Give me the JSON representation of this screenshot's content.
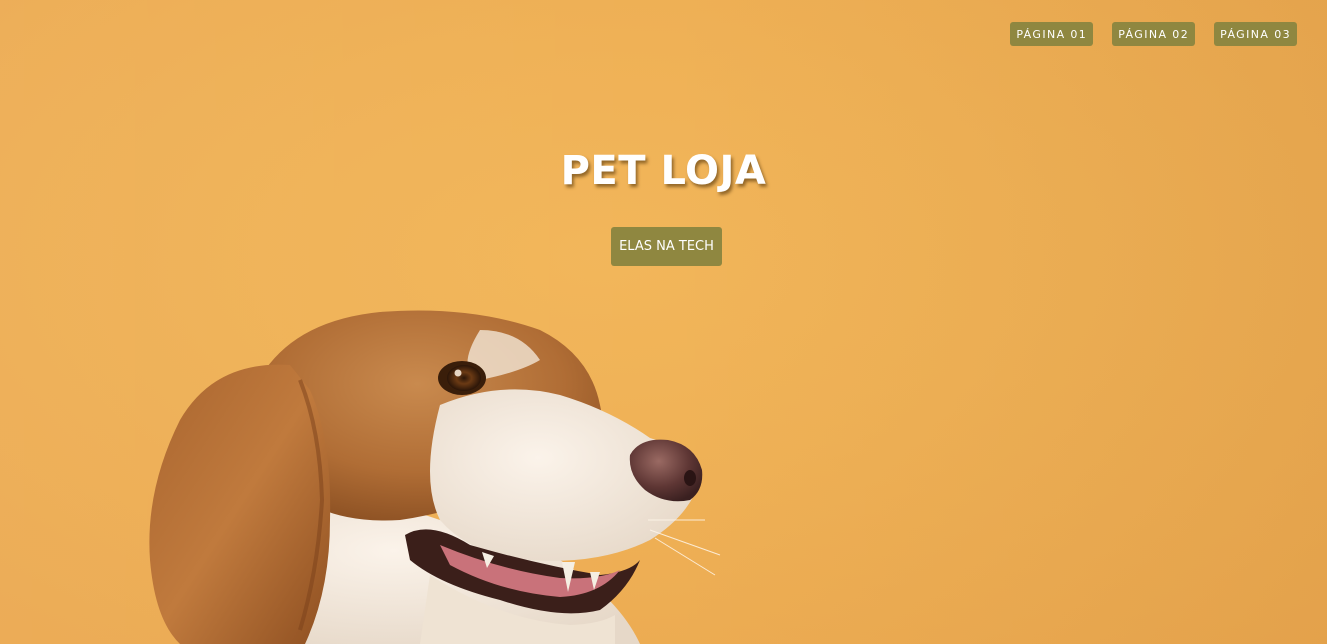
{
  "nav": {
    "items": [
      {
        "label": "PÁGINA 01"
      },
      {
        "label": "PÁGINA 02"
      },
      {
        "label": "PÁGINA 03"
      }
    ]
  },
  "hero": {
    "title": "PET LOJA",
    "button_label": "ELAS NA TECH"
  },
  "colors": {
    "background": "#efb156",
    "button": "#8f8740",
    "button_text": "#ffffff"
  },
  "image": {
    "subject": "beagle-dog-photo"
  }
}
